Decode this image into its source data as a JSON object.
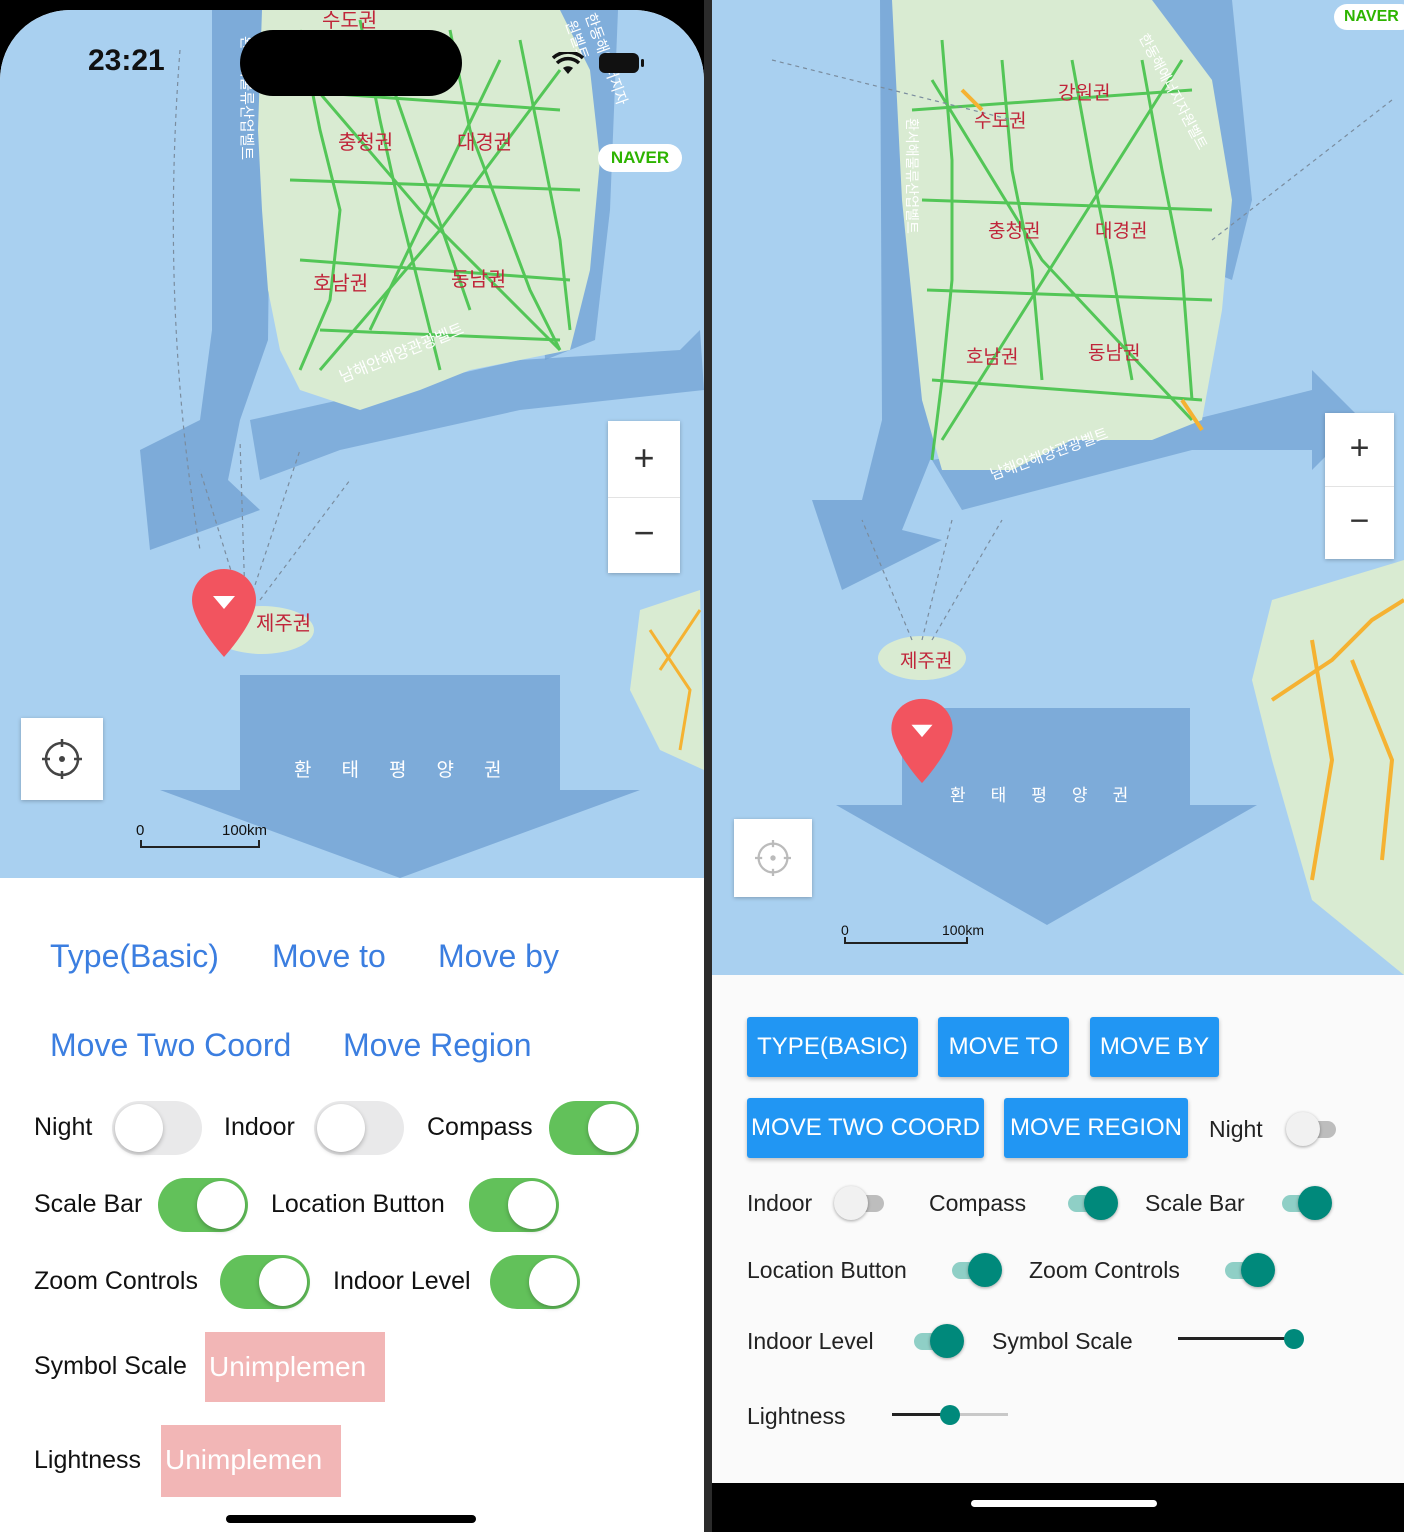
{
  "ios": {
    "status": {
      "time": "23:21"
    },
    "map": {
      "brand": "NAVER",
      "regions": [
        "수도권",
        "충청권",
        "대경권",
        "호남권",
        "동남권",
        "제주권"
      ],
      "belts": [
        "남해안해양관광벨트",
        "환서해물류산업벨트",
        "한동해에너지자원벨트"
      ],
      "pacific": [
        "환",
        "태",
        "평",
        "양",
        "권"
      ],
      "scale": {
        "zero": "0",
        "distance": "100km"
      },
      "zoom_in": "+",
      "zoom_out": "−"
    },
    "buttons": {
      "type": "Type(Basic)",
      "move_to": "Move to",
      "move_by": "Move by",
      "move_two_coord": "Move Two Coord",
      "move_region": "Move Region"
    },
    "toggles": [
      {
        "label": "Night",
        "on": false
      },
      {
        "label": "Indoor",
        "on": false
      },
      {
        "label": "Compass",
        "on": true
      },
      {
        "label": "Scale Bar",
        "on": true
      },
      {
        "label": "Location Button",
        "on": true
      },
      {
        "label": "Zoom Controls",
        "on": true
      },
      {
        "label": "Indoor Level",
        "on": true
      }
    ],
    "symbol_scale": {
      "label": "Symbol Scale",
      "value": "Unimplemen"
    },
    "lightness": {
      "label": "Lightness",
      "value": "Unimplemen"
    }
  },
  "android": {
    "map": {
      "brand": "NAVER",
      "regions": [
        "수도권",
        "강원권",
        "충청권",
        "대경권",
        "호남권",
        "동남권",
        "제주권"
      ],
      "belts": [
        "남해안해양관광벨트",
        "환서해물류산업벨트",
        "한동해에너지자원벨트"
      ],
      "pacific": [
        "환",
        "태",
        "평",
        "양",
        "권"
      ],
      "scale": {
        "zero": "0",
        "distance": "100km"
      },
      "zoom_in": "+",
      "zoom_out": "−"
    },
    "buttons": {
      "type": "TYPE(BASIC)",
      "move_to": "MOVE TO",
      "move_by": "MOVE BY",
      "move_two_coord": "MOVE TWO COORD",
      "move_region": "MOVE REGION"
    },
    "switches": [
      {
        "label": "Night",
        "on": false
      },
      {
        "label": "Indoor",
        "on": false
      },
      {
        "label": "Compass",
        "on": true
      },
      {
        "label": "Scale Bar",
        "on": true
      },
      {
        "label": "Location Button",
        "on": true
      },
      {
        "label": "Zoom Controls",
        "on": true
      },
      {
        "label": "Indoor Level",
        "on": true
      }
    ],
    "symbol_scale": {
      "label": "Symbol Scale",
      "value": 1.0
    },
    "lightness": {
      "label": "Lightness",
      "value": 0.5
    }
  },
  "colors": {
    "sea": "#a9d0f0",
    "land": "#d9ebd2",
    "belt": "#6f9fd2",
    "road": "#45c24a",
    "road_jp": "#f5b232",
    "region_label": "#c0253a",
    "marker": "#f2545f",
    "ios_accent": "#3b7ee0",
    "ios_toggle_on": "#62c15a",
    "md_primary": "#2196f3",
    "md_switch_on": "#00897b",
    "unimplemented": "#f2b6b6"
  }
}
